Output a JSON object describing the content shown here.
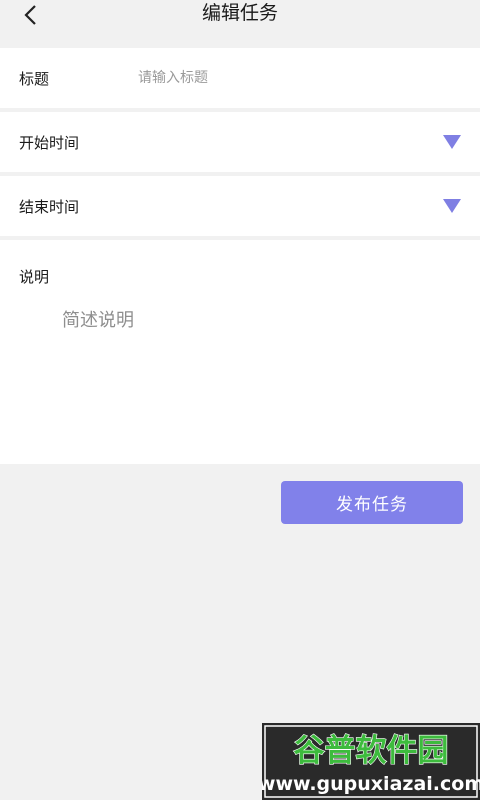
{
  "header": {
    "title": "编辑任务",
    "back_icon": "chevron-left-icon"
  },
  "form": {
    "title_field": {
      "label": "标题",
      "value": "",
      "placeholder": "请输入标题"
    },
    "start_time": {
      "label": "开始时间",
      "value": "",
      "icon": "triangle-down-icon"
    },
    "end_time": {
      "label": "结束时间",
      "value": "",
      "icon": "triangle-down-icon"
    },
    "description": {
      "label": "说明",
      "value": "",
      "placeholder": "简述说明"
    }
  },
  "actions": {
    "publish_label": "发布任务"
  },
  "watermark": {
    "brand_text": "谷普软件园",
    "url_text": "www.gupuxiazai.com"
  },
  "colors": {
    "accent": "#8181ea",
    "arrow": "#7f7fe3",
    "page_background": "#f1f1f1",
    "row_background": "#ffffff",
    "watermark_background": "#2a2a2a",
    "watermark_green": "#3dbb3d"
  }
}
